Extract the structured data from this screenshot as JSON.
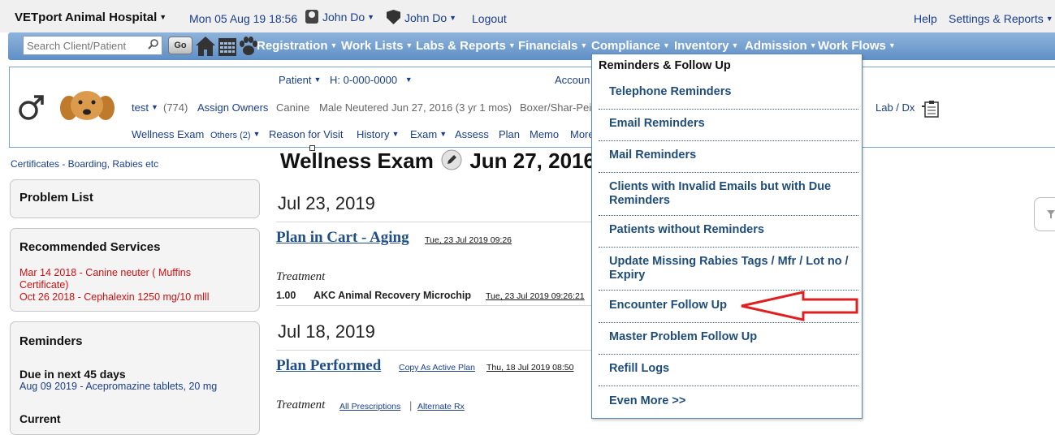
{
  "topbar": {
    "app_title": "VETport Animal Hospital",
    "datetime": "Mon 05 Aug 19 18:56",
    "user1": "John Do",
    "user2": "John Do",
    "logout": "Logout",
    "help": "Help",
    "settings": "Settings & Reports"
  },
  "navbar": {
    "search_placeholder": "Search Client/Patient",
    "go": "Go",
    "items": [
      "Registration",
      "Work Lists",
      "Labs & Reports",
      "Financials",
      "Compliance",
      "Inventory",
      "Admission",
      "Work Flows"
    ]
  },
  "patient_header": {
    "patient_label": "Patient",
    "patient_id": "H: 0-000-0000",
    "account_label": "Accoun",
    "pet_name": "test",
    "pet_count": "(774)",
    "assign_owners": "Assign Owners",
    "species": "Canine",
    "sex": "Male Neutered",
    "dob": "Jun 27, 2016 (3 yr 1 mos)",
    "breed": "Boxer/Shar-Pei",
    "lab_dx": "Lab / Dx",
    "links": {
      "wellness_exam": "Wellness Exam",
      "others": "Others (2)",
      "reason": "Reason for Visit",
      "history": "History",
      "exam": "Exam",
      "assess": "Assess",
      "plan": "Plan",
      "memo": "Memo",
      "more": "More"
    }
  },
  "sidebar": {
    "certificates": "Certificates - Boarding, Rabies etc",
    "problem_list": "Problem List",
    "recommended_title": "Recommended Services",
    "recommended": [
      "Mar 14 2018 - Canine neuter ( Muffins Certificate)",
      "Oct 26 2018 - Cephalexin 1250 mg/10 mlll"
    ],
    "reminders_title": "Reminders",
    "due_title": "Due in next 45 days",
    "due_item": "Aug 09 2019 - Acepromazine tablets, 20 mg",
    "current": "Current"
  },
  "main": {
    "exam_title": "Wellness Exam",
    "exam_date": "Jun 27, 2016",
    "section1": {
      "date": "Jul 23, 2019",
      "plan": "Plan in Cart - Aging",
      "plan_ts": "Tue, 23 Jul 2019 09:26",
      "treatment": "Treatment",
      "qty": "1.00",
      "item": "AKC Animal Recovery Microchip",
      "item_ts": "Tue, 23 Jul 2019 09:26:21"
    },
    "section2": {
      "date": "Jul 18, 2019",
      "plan": "Plan Performed",
      "copy": "Copy As Active Plan",
      "plan_ts": "Thu, 18 Jul 2019 08:50",
      "treatment": "Treatment",
      "all_rx": "All Prescriptions",
      "alt_rx": "Alternate Rx"
    }
  },
  "dropdown": {
    "header": "Reminders & Follow Up",
    "items": [
      "Telephone Reminders",
      "Email Reminders",
      "Mail Reminders",
      "Clients with Invalid Emails but with Due Reminders",
      "Patients without Reminders",
      "Update Missing Rabies Tags / Mfr / Lot no / Expiry",
      "Encounter Follow Up",
      "Master Problem Follow Up",
      "Refill Logs",
      "Even More >>"
    ],
    "annotation_color": "#e02020"
  }
}
